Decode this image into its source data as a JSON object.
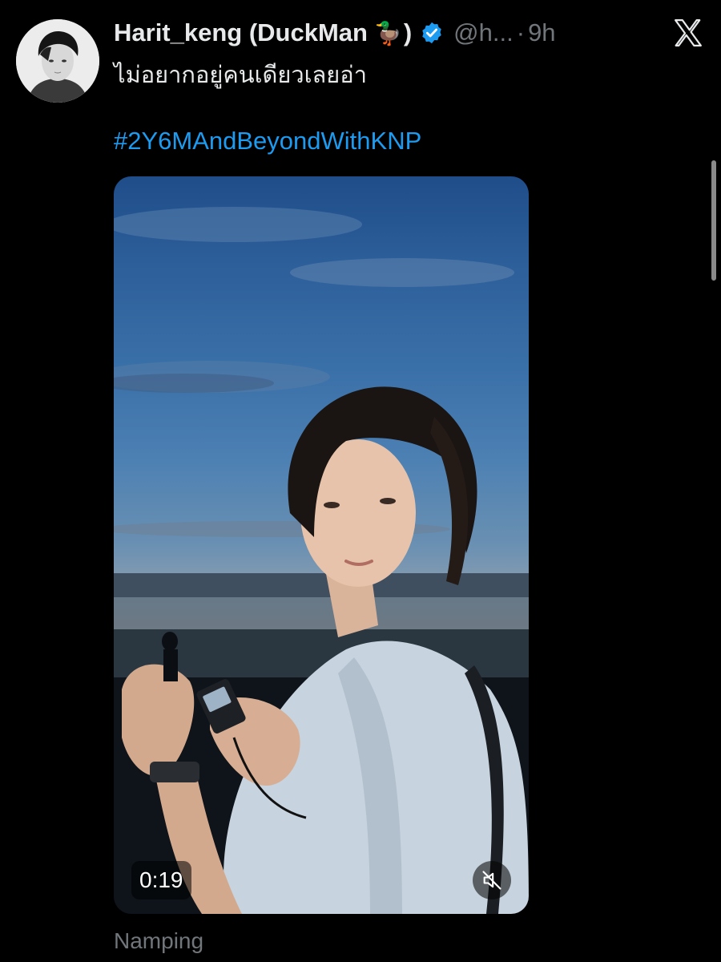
{
  "tweet": {
    "display_name": "Harit_keng (DuckMan",
    "display_emoji": "🦆",
    "display_close": ")",
    "handle": "@h...",
    "separator": "·",
    "time": "9h",
    "text": "ไม่อยากอยู่คนเดียวเลยอ่า",
    "hashtag": "#2Y6MAndBeyondWithKNP",
    "media": {
      "duration": "0:19",
      "muted": true
    },
    "caption": "Namping"
  },
  "icons": {
    "verified": "verified-badge-icon",
    "platform": "x-logo-icon",
    "mute": "speaker-muted-icon"
  },
  "colors": {
    "background": "#000000",
    "text": "#e7e9ea",
    "secondary": "#71767b",
    "accent": "#1d9bf0"
  }
}
